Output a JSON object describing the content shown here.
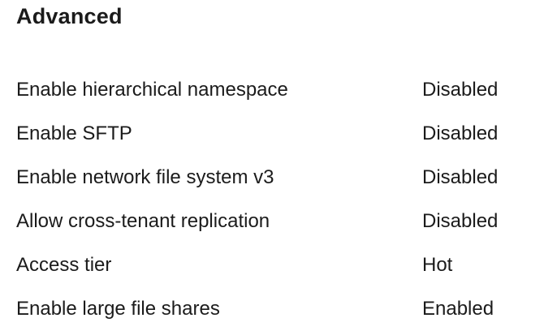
{
  "section": {
    "title": "Advanced"
  },
  "properties": [
    {
      "label": "Enable hierarchical namespace",
      "value": "Disabled"
    },
    {
      "label": "Enable SFTP",
      "value": "Disabled"
    },
    {
      "label": "Enable network file system v3",
      "value": "Disabled"
    },
    {
      "label": "Allow cross-tenant replication",
      "value": "Disabled"
    },
    {
      "label": "Access tier",
      "value": "Hot"
    },
    {
      "label": "Enable large file shares",
      "value": "Enabled"
    }
  ]
}
